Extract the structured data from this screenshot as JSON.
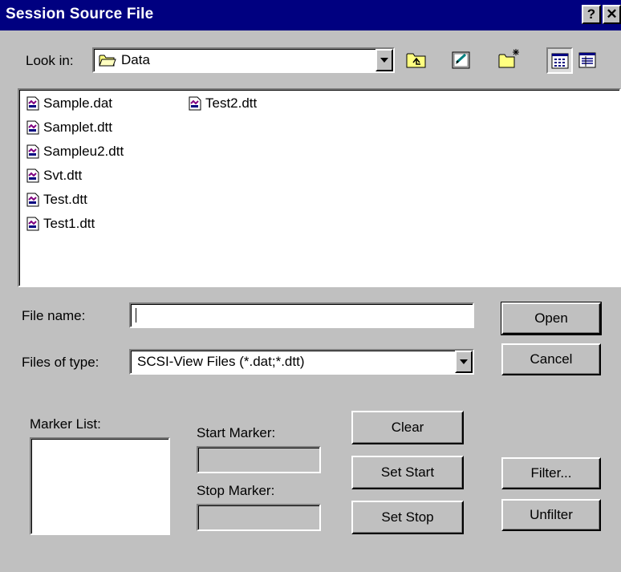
{
  "window": {
    "title": "Session Source File",
    "help_glyph": "?",
    "close_glyph": "✕"
  },
  "toolbar": {
    "look_in_label": "Look in:",
    "look_in_value": "Data",
    "buttons": [
      "up-folder-icon",
      "desktop-icon",
      "new-folder-icon",
      "list-view-icon",
      "details-view-icon"
    ]
  },
  "files": [
    {
      "name": "Sample.dat",
      "icon": "document-icon"
    },
    {
      "name": "Samplet.dtt",
      "icon": "document-icon"
    },
    {
      "name": "Sampleu2.dtt",
      "icon": "document-icon"
    },
    {
      "name": "Svt.dtt",
      "icon": "document-icon"
    },
    {
      "name": "Test.dtt",
      "icon": "document-icon"
    },
    {
      "name": "Test1.dtt",
      "icon": "document-icon"
    },
    {
      "name": "Test2.dtt",
      "icon": "document-icon"
    }
  ],
  "file_name": {
    "label": "File name:",
    "value": ""
  },
  "files_of_type": {
    "label": "Files of type:",
    "value": "SCSI-View Files (*.dat;*.dtt)"
  },
  "buttons": {
    "open": "Open",
    "cancel": "Cancel",
    "clear": "Clear",
    "set_start": "Set Start",
    "set_stop": "Set Stop",
    "filter": "Filter...",
    "unfilter": "Unfilter"
  },
  "markers": {
    "list_label": "Marker List:",
    "start_label": "Start Marker:",
    "stop_label": "Stop Marker:",
    "start_value": "",
    "stop_value": ""
  }
}
